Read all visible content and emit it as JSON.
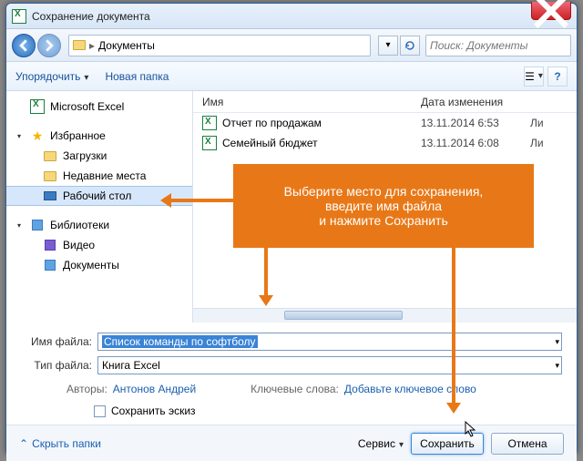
{
  "window": {
    "title": "Сохранение документа"
  },
  "nav": {
    "location": "Документы"
  },
  "search": {
    "placeholder": "Поиск: Документы"
  },
  "toolbar": {
    "organize": "Упорядочить",
    "newfolder": "Новая папка"
  },
  "sidebar": {
    "excel": "Microsoft Excel",
    "favorites": "Избранное",
    "downloads": "Загрузки",
    "recent": "Недавние места",
    "desktop": "Рабочий стол",
    "libraries": "Библиотеки",
    "video": "Видео",
    "documents": "Документы"
  },
  "columns": {
    "name": "Имя",
    "date": "Дата изменения",
    "type": ""
  },
  "files": [
    {
      "name": "Отчет по продажам",
      "date": "13.11.2014 6:53",
      "type": "Ли"
    },
    {
      "name": "Семейный бюджет",
      "date": "13.11.2014 6:08",
      "type": "Ли"
    }
  ],
  "form": {
    "filename_label": "Имя файла:",
    "filename_value": "Список команды по софтболу",
    "filetype_label": "Тип файла:",
    "filetype_value": "Книга Excel",
    "authors_label": "Авторы:",
    "authors_value": "Антонов Андрей",
    "keywords_label": "Ключевые слова:",
    "keywords_value": "Добавьте ключевое слово",
    "thumbnail": "Сохранить эскиз"
  },
  "footer": {
    "hide": "Скрыть папки",
    "tools": "Сервис",
    "save": "Сохранить",
    "cancel": "Отмена"
  },
  "callout": {
    "l1": "Выберите место для сохранения,",
    "l2": "введите имя файла",
    "l3": "и нажмите Сохранить"
  }
}
